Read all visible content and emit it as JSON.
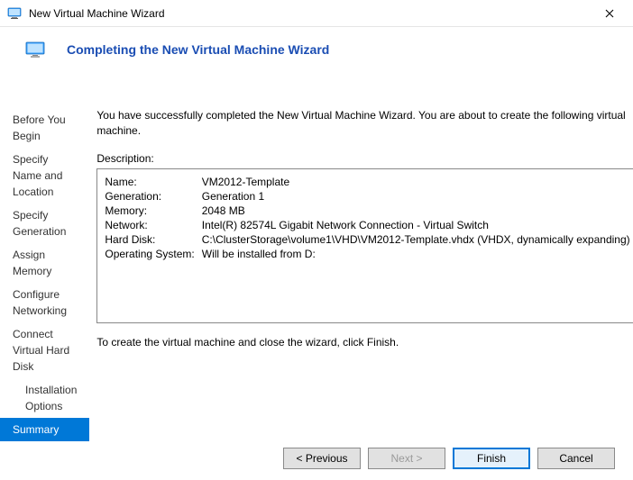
{
  "window": {
    "title": "New Virtual Machine Wizard"
  },
  "heading": "Completing the New Virtual Machine Wizard",
  "steps": [
    {
      "label": "Before You Begin",
      "active": false,
      "indent": false
    },
    {
      "label": "Specify Name and Location",
      "active": false,
      "indent": false
    },
    {
      "label": "Specify Generation",
      "active": false,
      "indent": false
    },
    {
      "label": "Assign Memory",
      "active": false,
      "indent": false
    },
    {
      "label": "Configure Networking",
      "active": false,
      "indent": false
    },
    {
      "label": "Connect Virtual Hard Disk",
      "active": false,
      "indent": false
    },
    {
      "label": "Installation Options",
      "active": false,
      "indent": true
    },
    {
      "label": "Summary",
      "active": true,
      "indent": false
    }
  ],
  "intro": "You have successfully completed the New Virtual Machine Wizard. You are about to create the following virtual machine.",
  "description_label": "Description:",
  "summary_fields": [
    {
      "key": "Name:",
      "value": "VM2012-Template"
    },
    {
      "key": "Generation:",
      "value": "Generation 1"
    },
    {
      "key": "Memory:",
      "value": "2048 MB"
    },
    {
      "key": "Network:",
      "value": "Intel(R) 82574L Gigabit Network Connection - Virtual Switch"
    },
    {
      "key": "Hard Disk:",
      "value": "C:\\ClusterStorage\\volume1\\VHD\\VM2012-Template.vhdx (VHDX, dynamically expanding)"
    },
    {
      "key": "Operating System:",
      "value": "Will be installed from D:"
    }
  ],
  "outro": "To create the virtual machine and close the wizard, click Finish.",
  "buttons": {
    "previous": "< Previous",
    "next": "Next >",
    "finish": "Finish",
    "cancel": "Cancel"
  }
}
